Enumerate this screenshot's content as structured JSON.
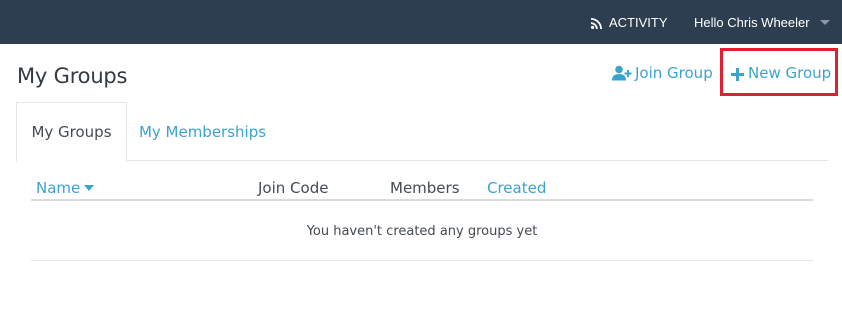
{
  "navbar": {
    "activity_label": "ACTIVITY",
    "activity_icon": "rss-icon",
    "user_greeting": "Hello Chris Wheeler",
    "user_menu_icon": "caret-down-icon",
    "background_color": "#2c3e50"
  },
  "header": {
    "title": "My Groups",
    "join_group_label": "Join Group",
    "join_group_icon": "user-plus-icon",
    "new_group_label": "New Group",
    "new_group_icon": "plus-icon",
    "accent_color": "#3aa4cf",
    "highlight_color": "#e0202e"
  },
  "tabs": [
    {
      "label": "My Groups",
      "active": true
    },
    {
      "label": "My Memberships",
      "active": false
    }
  ],
  "table": {
    "columns": [
      {
        "label": "Name",
        "sortable": true,
        "sorted": "desc"
      },
      {
        "label": "Join Code",
        "sortable": false
      },
      {
        "label": "Members",
        "sortable": false
      },
      {
        "label": "Created",
        "sortable": true
      }
    ],
    "empty_message": "You haven't created any groups yet"
  }
}
